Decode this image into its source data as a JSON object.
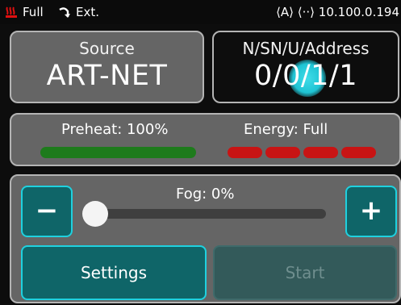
{
  "status_bar": {
    "fuel": "Full",
    "mode": "Ext.",
    "network": "⟨A⟩ ⟨··⟩ 10.100.0.194",
    "icons": {
      "heat": "heater-icon",
      "mode": "curve-arrow-icon"
    },
    "heat_color": "#e01010"
  },
  "source": {
    "label": "Source",
    "value": "ART-NET"
  },
  "address": {
    "label": "N/SN/U/Address",
    "parts": [
      "0",
      "/",
      "0",
      "/",
      "1",
      "/",
      "1"
    ]
  },
  "status": {
    "preheat_label": "Preheat: 100%",
    "preheat_level": 1.0,
    "energy_label": "Energy: Full",
    "energy_segments_filled": 4,
    "energy_segments_total": 4,
    "preheat_color": "#1e7b1c",
    "energy_color": "#c81414"
  },
  "control": {
    "fog_label": "Fog: 0%",
    "fog_level": 0,
    "minus_label": "−",
    "plus_label": "+",
    "settings_label": "Settings",
    "start_label": "Start",
    "accent_color": "#1fd1df"
  }
}
